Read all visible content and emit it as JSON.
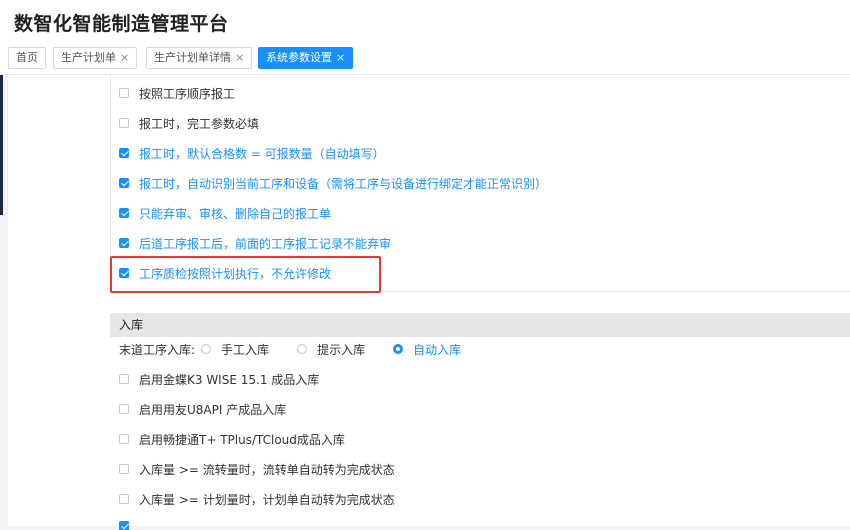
{
  "header": {
    "title": "数智化智能制造管理平台"
  },
  "tabs": [
    {
      "label": "首页",
      "closable": false,
      "active": false
    },
    {
      "label": "生产计划单",
      "closable": true,
      "active": false
    },
    {
      "label": "生产计划单详情",
      "closable": true,
      "active": false
    },
    {
      "label": "系统参数设置",
      "closable": true,
      "active": true
    }
  ],
  "close_glyph": "×",
  "reporting": {
    "options": [
      {
        "label": "按照工序顺序报工",
        "checked": false
      },
      {
        "label": "报工时，完工参数必填",
        "checked": false
      },
      {
        "label": "报工时，默认合格数 = 可报数量（自动填写）",
        "checked": true
      },
      {
        "label": "报工时，自动识别当前工序和设备（需将工序与设备进行绑定才能正常识别）",
        "checked": true
      },
      {
        "label": "只能弃审、审核、删除自己的报工单",
        "checked": true
      },
      {
        "label": "后道工序报工后，前面的工序报工记录不能弃审",
        "checked": true
      },
      {
        "label": "工序质检按照计划执行，不允许修改",
        "checked": true
      }
    ]
  },
  "warehousing": {
    "title": "入库",
    "radio_label": "末道工序入库:",
    "radio_options": [
      {
        "label": "手工入库",
        "selected": false
      },
      {
        "label": "提示入库",
        "selected": false
      },
      {
        "label": "自动入库",
        "selected": true
      }
    ],
    "options": [
      {
        "label": "启用金蝶K3 WISE 15.1 成品入库",
        "checked": false
      },
      {
        "label": "启用用友U8API 产成品入库",
        "checked": false
      },
      {
        "label": "启用畅捷通T+ TPlus/TCloud成品入库",
        "checked": false
      },
      {
        "label": "入库量 >= 流转量时，流转单自动转为完成状态",
        "checked": false
      },
      {
        "label": "入库量 >= 计划量时，计划单自动转为完成状态",
        "checked": false
      }
    ]
  },
  "colors": {
    "accent": "#1890ff",
    "highlight": "#e53935",
    "sidebar": "#1a2a45"
  }
}
